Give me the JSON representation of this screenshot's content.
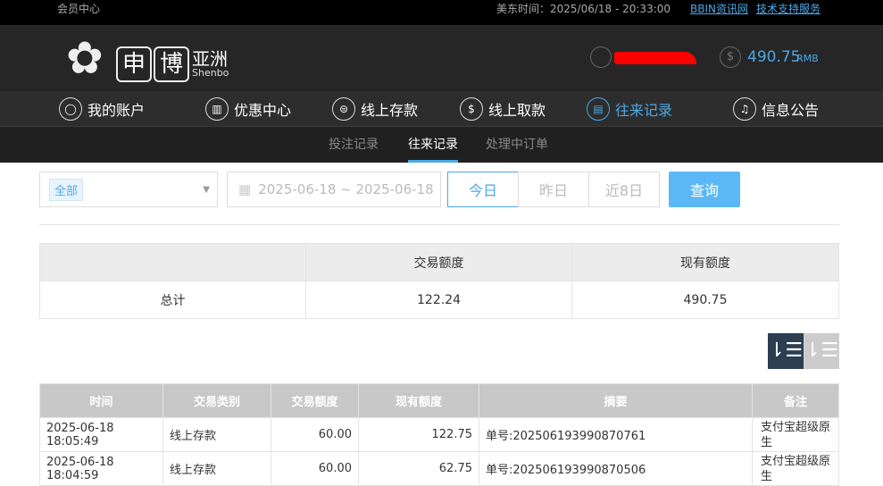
{
  "topbar": {
    "member_center": "会员中心",
    "time_label": "美东时间：2025/06/18 - 20:33:00",
    "links": [
      "BBIN资讯网",
      "技术支持服务"
    ]
  },
  "header": {
    "logo_chars": [
      "申",
      "博"
    ],
    "logo_cn": "亚洲",
    "logo_en": "Shenbo",
    "balance": "490.75",
    "currency": "RMB"
  },
  "nav": [
    {
      "label": "我的账户",
      "icon": "user-icon"
    },
    {
      "label": "优惠中心",
      "icon": "gift-icon"
    },
    {
      "label": "线上存款",
      "icon": "deposit-icon"
    },
    {
      "label": "线上取款",
      "icon": "withdraw-icon"
    },
    {
      "label": "往来记录",
      "icon": "record-icon",
      "active": true
    },
    {
      "label": "信息公告",
      "icon": "bell-icon"
    }
  ],
  "subnav": [
    {
      "label": "投注记录"
    },
    {
      "label": "往来记录",
      "active": true
    },
    {
      "label": "处理中订单"
    }
  ],
  "filter": {
    "type_value": "全部",
    "date_range": "2025-06-18 ~ 2025-06-18",
    "quick": [
      "今日",
      "昨日",
      "近8日"
    ],
    "query": "查询"
  },
  "summary": {
    "headers": [
      "",
      "交易额度",
      "现有额度"
    ],
    "row": [
      "总计",
      "122.24",
      "490.75"
    ]
  },
  "table": {
    "headers": [
      "时间",
      "交易类别",
      "交易额度",
      "现有额度",
      "摘要",
      "备注"
    ],
    "rows": [
      [
        "2025-06-18 18:05:49",
        "线上存款",
        "60.00",
        "122.75",
        "单号:202506193990870761",
        "支付宝超级原生"
      ],
      [
        "2025-06-18 18:04:59",
        "线上存款",
        "60.00",
        "62.75",
        "单号:202506193990870506",
        "支付宝超级原生"
      ]
    ]
  },
  "colors": {
    "accent": "#4aa8e8",
    "query_button": "#5bb8f5",
    "sort_active": "#2c3e50"
  }
}
